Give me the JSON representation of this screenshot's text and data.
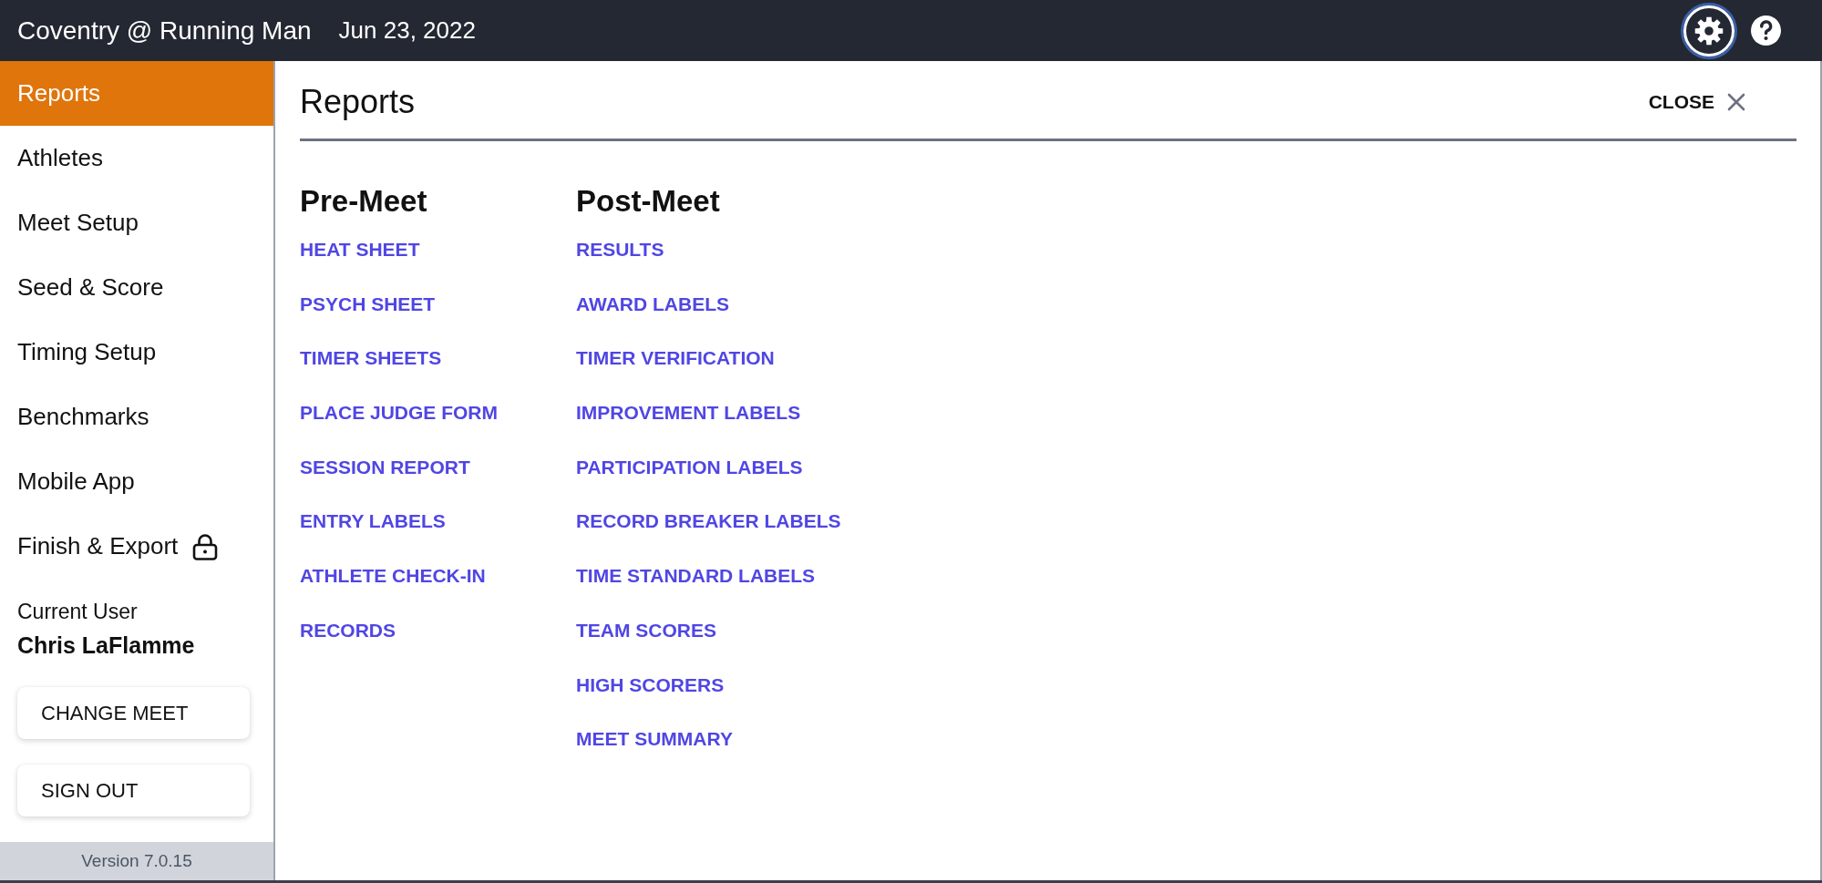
{
  "header": {
    "title": "Coventry @ Running Man",
    "date": "Jun 23, 2022",
    "icons": [
      {
        "kind": "settings",
        "focused": true
      },
      {
        "kind": "help",
        "focused": false
      }
    ]
  },
  "sidebar": {
    "items": [
      {
        "label": "Reports",
        "selected": true,
        "locked": false
      },
      {
        "label": "Athletes",
        "selected": false,
        "locked": false
      },
      {
        "label": "Meet Setup",
        "selected": false,
        "locked": false
      },
      {
        "label": "Seed & Score",
        "selected": false,
        "locked": false
      },
      {
        "label": "Timing Setup",
        "selected": false,
        "locked": false
      },
      {
        "label": "Benchmarks",
        "selected": false,
        "locked": false
      },
      {
        "label": "Mobile App",
        "selected": false,
        "locked": false
      },
      {
        "label": "Finish & Export",
        "selected": false,
        "locked": true
      }
    ],
    "user": {
      "caption": "Current User",
      "name": "Chris LaFlamme"
    },
    "buttons": [
      "CHANGE MEET",
      "SIGN OUT"
    ],
    "version": "Version 7.0.15"
  },
  "panel": {
    "title": "Reports",
    "close": "CLOSE",
    "sections": [
      {
        "heading": "Pre-Meet",
        "links": [
          "HEAT SHEET",
          "PSYCH SHEET",
          "TIMER SHEETS",
          "PLACE JUDGE FORM",
          "SESSION REPORT",
          "ENTRY LABELS",
          "ATHLETE CHECK-IN",
          "RECORDS"
        ]
      },
      {
        "heading": "Post-Meet",
        "links": [
          "RESULTS",
          "AWARD LABELS",
          "TIMER VERIFICATION",
          "IMPROVEMENT LABELS",
          "PARTICIPATION LABELS",
          "RECORD BREAKER LABELS",
          "TIME STANDARD LABELS",
          "TEAM SCORES",
          "HIGH SCORERS",
          "MEET SUMMARY"
        ]
      }
    ]
  }
}
